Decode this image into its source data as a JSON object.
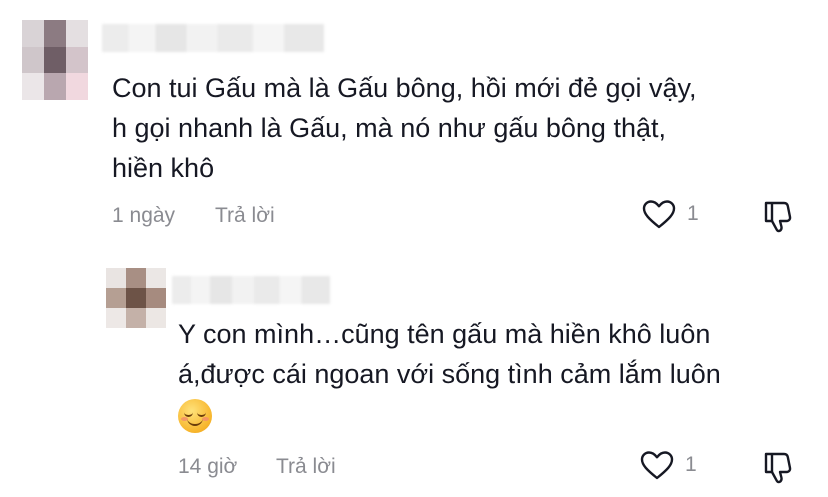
{
  "comments": [
    {
      "text_lines": [
        "Con tui Gấu mà là Gấu bông, hồi mới đẻ gọi vậy,",
        "h gọi nhanh là Gấu, mà nó như gấu bông thật,",
        "hiền khô"
      ],
      "time": "1 ngày",
      "reply_label": "Trả lời",
      "likes": "1",
      "icons": {
        "like": "heart-outline-icon",
        "dislike": "thumbs-down-outline-icon"
      }
    },
    {
      "text_lines": [
        "Y con mình…cũng tên gấu mà hiền khô luôn",
        "á,được cái ngoan với sống tình cảm lắm luôn"
      ],
      "emoji": "☺️",
      "time": "14 giờ",
      "reply_label": "Trả lời",
      "likes": "1",
      "icons": {
        "like": "heart-outline-icon",
        "dislike": "thumbs-down-outline-icon"
      }
    }
  ],
  "colors": {
    "text": "#161823",
    "meta": "#8a8b91",
    "background": "#ffffff"
  }
}
